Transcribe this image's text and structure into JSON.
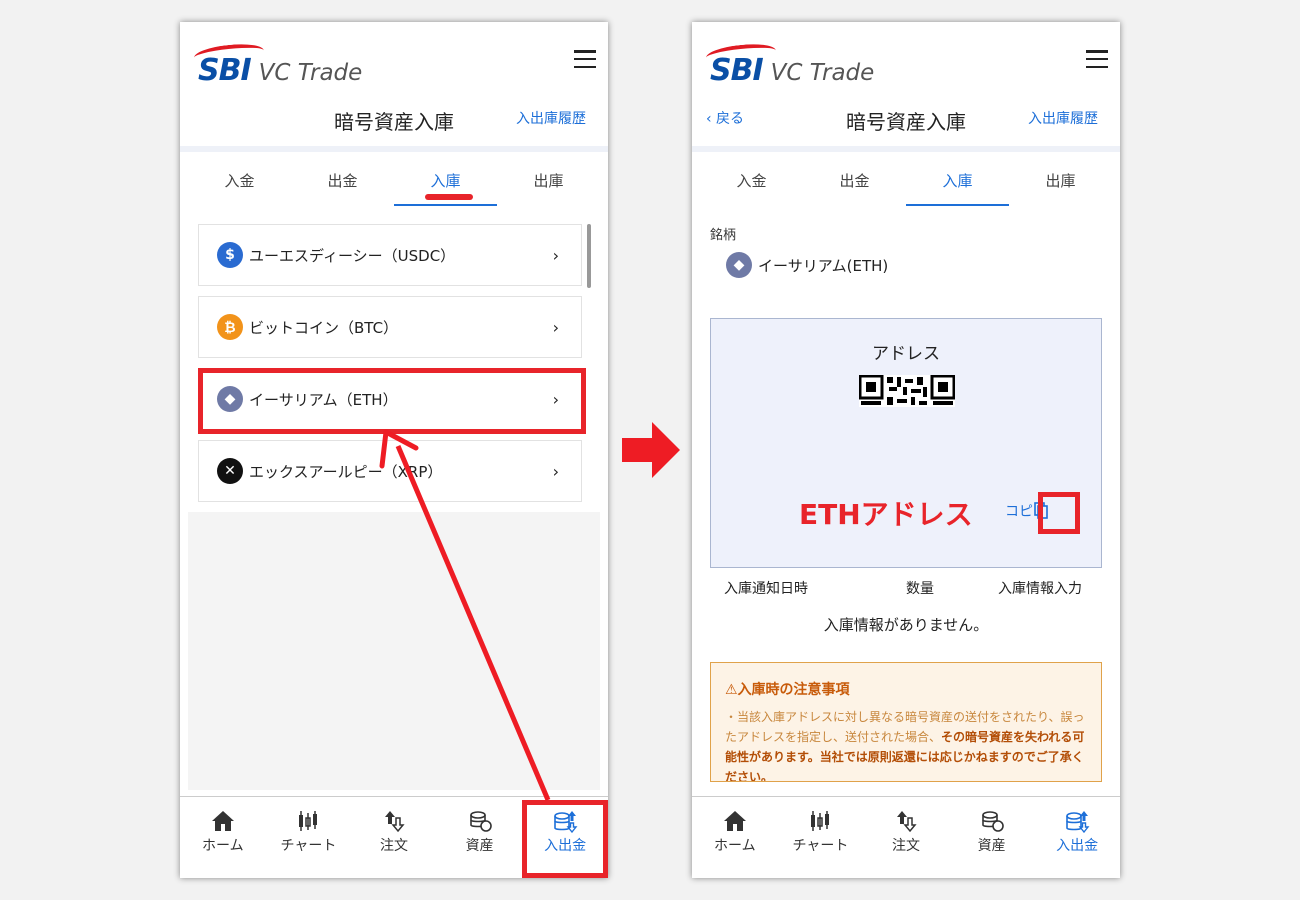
{
  "brand": {
    "logo_main": "SBI",
    "logo_sub": "VC Trade"
  },
  "left_screen": {
    "header": {
      "title": "暗号資産入庫",
      "history_link": "入出庫履歴"
    },
    "tabs": [
      {
        "label": "入金",
        "active": false
      },
      {
        "label": "出金",
        "active": false
      },
      {
        "label": "入庫",
        "active": true
      },
      {
        "label": "出庫",
        "active": false
      }
    ],
    "coins": [
      {
        "label": "ユーエスディーシー（USDC）",
        "icon": "usdc-icon",
        "color": "#2a6bd1",
        "glyph": "$"
      },
      {
        "label": "ビットコイン（BTC）",
        "icon": "btc-icon",
        "color": "#f2931a",
        "glyph": "₿"
      },
      {
        "label": "イーサリアム（ETH）",
        "icon": "eth-icon",
        "color": "#6f7aa6",
        "glyph": "◆"
      },
      {
        "label": "エックスアールピー（XRP）",
        "icon": "xrp-icon",
        "color": "#111111",
        "glyph": "✕"
      }
    ],
    "chevron": "›"
  },
  "right_screen": {
    "header": {
      "back": "‹ 戻る",
      "title": "暗号資産入庫",
      "history_link": "入出庫履歴"
    },
    "tabs": [
      {
        "label": "入金",
        "active": false
      },
      {
        "label": "出金",
        "active": false
      },
      {
        "label": "入庫",
        "active": true
      },
      {
        "label": "出庫",
        "active": false
      }
    ],
    "section_label": "銘柄",
    "selected_coin": "イーサリアム(ETH)",
    "address_panel": {
      "title": "アドレス",
      "address_placeholder": "ETHアドレス",
      "copy_label": "コピー"
    },
    "info_columns": [
      "入庫通知日時",
      "数量",
      "入庫情報入力"
    ],
    "no_info": "入庫情報がありません。",
    "notice": {
      "title": "⚠入庫時の注意事項",
      "body_plain": "・当該入庫アドレスに対し異なる暗号資産の送付をされたり、誤ったアドレスを指定し、送付された場合、",
      "body_bold": "その暗号資産を失われる可能性があります。当社では原則返還には応じかねますのでご了承ください。"
    }
  },
  "bottom_nav": [
    {
      "label": "ホーム",
      "icon": "home-icon"
    },
    {
      "label": "チャート",
      "icon": "chart-icon"
    },
    {
      "label": "注文",
      "icon": "order-icon"
    },
    {
      "label": "資産",
      "icon": "assets-icon"
    },
    {
      "label": "入出金",
      "icon": "deposit-withdraw-icon",
      "active": true
    }
  ],
  "colors": {
    "accent": "#1d6fd8",
    "highlight": "#e8242a",
    "brand_blue": "#0a4fa6"
  }
}
